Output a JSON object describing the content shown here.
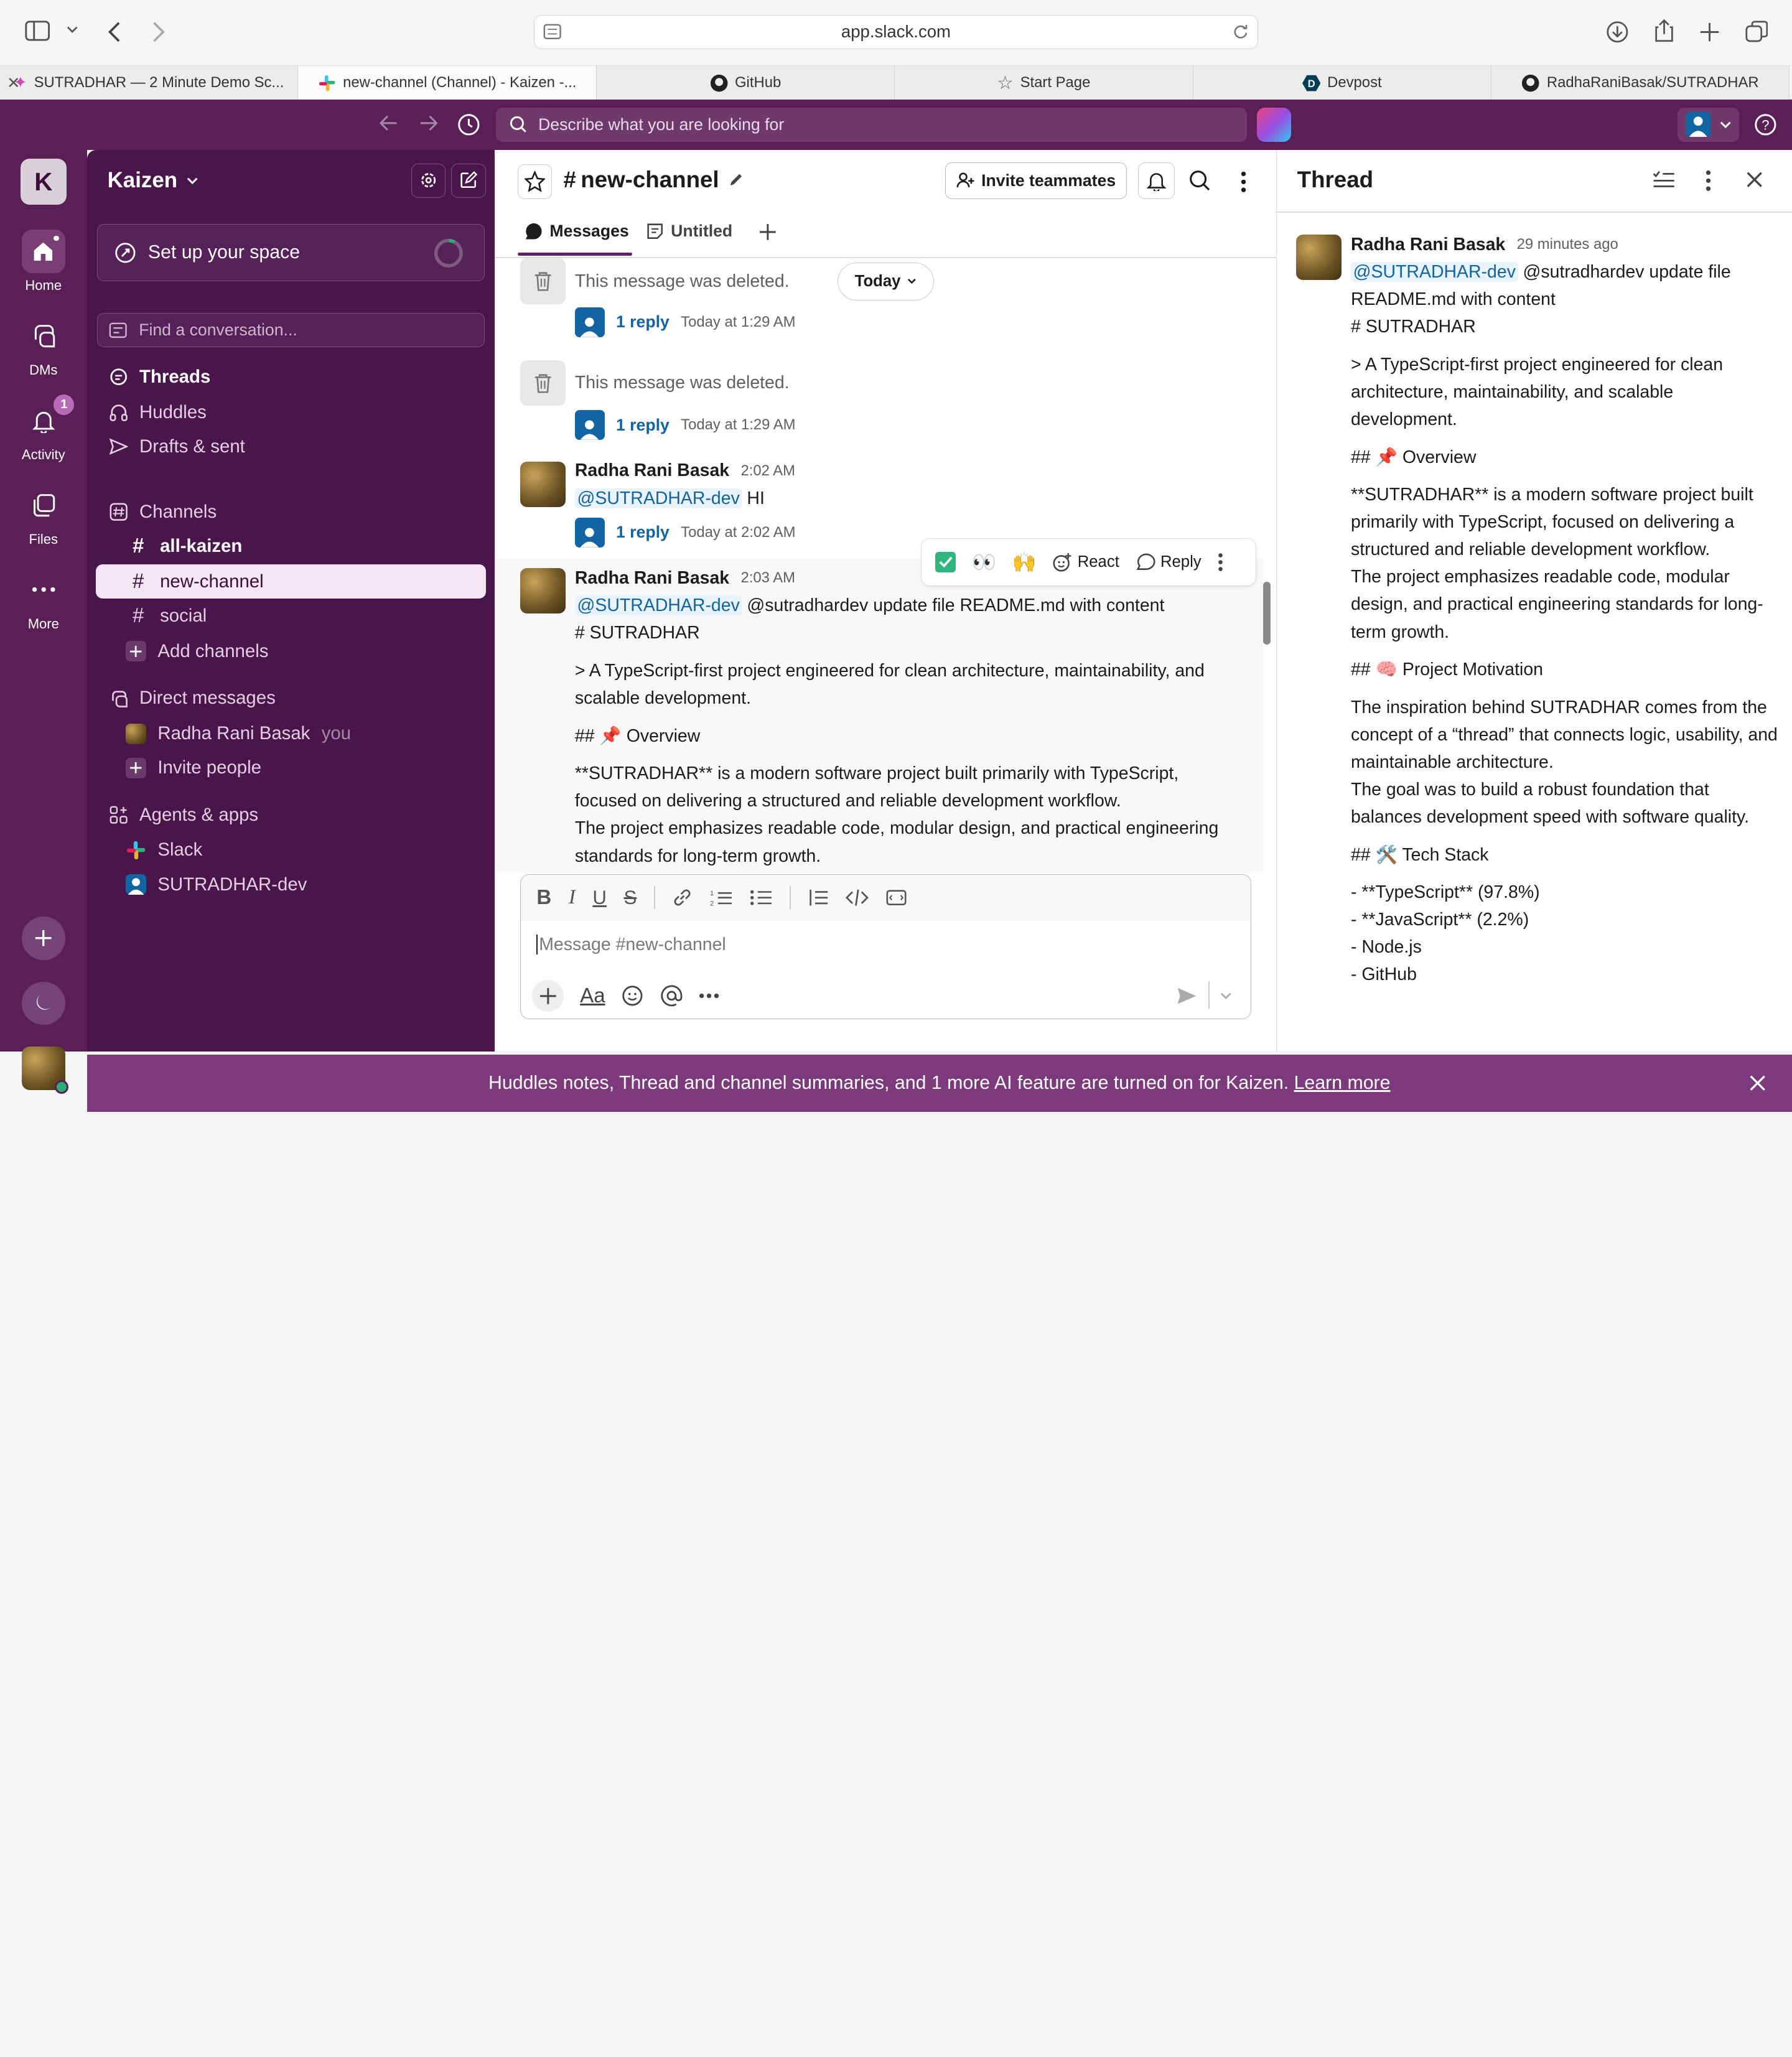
{
  "browser": {
    "url": "app.slack.com",
    "tabs": [
      {
        "label": "SUTRADHAR — 2 Minute Demo Sc...",
        "icon": "sparkle-icon"
      },
      {
        "label": "new-channel (Channel) - Kaizen -...",
        "icon": "slack-icon",
        "active": true
      },
      {
        "label": "GitHub",
        "icon": "github-icon"
      },
      {
        "label": "Start Page",
        "icon": "star-icon"
      },
      {
        "label": "Devpost",
        "icon": "devpost-icon"
      },
      {
        "label": "RadhaRaniBasak/SUTRADHAR",
        "icon": "github-icon"
      }
    ]
  },
  "topbar": {
    "search_placeholder": "Describe what you are looking for"
  },
  "rail": {
    "workspace_initial": "K",
    "items": [
      {
        "label": "Home",
        "icon": "home-icon"
      },
      {
        "label": "DMs",
        "icon": "dm-icon"
      },
      {
        "label": "Activity",
        "icon": "bell-icon",
        "badge": "1"
      },
      {
        "label": "Files",
        "icon": "files-icon"
      },
      {
        "label": "More",
        "icon": "more-icon"
      }
    ]
  },
  "sidebar": {
    "workspace": "Kaizen",
    "setup": "Set up your space",
    "find_placeholder": "Find a conversation...",
    "nav": [
      "Threads",
      "Huddles",
      "Drafts & sent"
    ],
    "channels_header": "Channels",
    "channels": [
      "all-kaizen",
      "new-channel",
      "social"
    ],
    "add_channels": "Add channels",
    "dm_header": "Direct messages",
    "dm_user": "Radha Rani Basak",
    "dm_you": "you",
    "invite_people": "Invite people",
    "apps_header": "Agents & apps",
    "apps": [
      "Slack",
      "SUTRADHAR-dev"
    ]
  },
  "channel": {
    "name": "new-channel",
    "invite": "Invite teammates",
    "tabs": [
      "Messages",
      "Untitled"
    ],
    "date_divider": "Today",
    "deleted_text": "This message was deleted.",
    "reply_label": "1 reply",
    "deleted_reply_times": [
      "Today at 1:29 AM",
      "Today at 1:29 AM"
    ],
    "msg1": {
      "author": "Radha Rani Basak",
      "time": "2:02 AM",
      "mention": "@SUTRADHAR-dev",
      "text": "HI",
      "reply_time": "Today at 2:02 AM"
    },
    "msg2": {
      "author": "Radha Rani Basak",
      "time": "2:03 AM",
      "mention": "@SUTRADHAR-dev",
      "line1": "@sutradhardev update file README.md with content",
      "line2": "# SUTRADHAR",
      "line3": "> A TypeScript-first project engineered for clean architecture, maintainability, and scalable development.",
      "line4": "## 📌 Overview",
      "line5": "**SUTRADHAR** is a modern software project built primarily with TypeScript, focused on delivering a structured and reliable development workflow.",
      "line6": "The project emphasizes readable code, modular design, and practical engineering standards for long-term growth."
    },
    "hover_actions": {
      "react": "React",
      "reply": "Reply"
    },
    "composer_placeholder": "Message #new-channel"
  },
  "thread": {
    "title": "Thread",
    "author": "Radha Rani Basak",
    "time": "29 minutes ago",
    "mention": "@SUTRADHAR-dev",
    "p1a": "@sutradhardev update file",
    "p1b": "README.md with content",
    "p1c": "# SUTRADHAR",
    "p2": "> A TypeScript-first project engineered for clean architecture, maintainability, and scalable development.",
    "h1": "## 📌 Overview",
    "p3": "**SUTRADHAR** is a modern software project built primarily with TypeScript, focused on delivering a structured and reliable development workflow.",
    "p4": "The project emphasizes readable code, modular design, and practical engineering standards for long-term growth.",
    "h2": "## 🧠 Project Motivation",
    "p5": "The inspiration behind SUTRADHAR comes from the concept of a “thread” that connects logic, usability, and maintainable architecture.",
    "p6": "The goal was to build a robust foundation that balances development speed with software quality.",
    "h3": "## 🛠️ Tech Stack",
    "list": [
      "- **TypeScript** (97.8%)",
      "- **JavaScript** (2.2%)",
      "- Node.js",
      "- GitHub"
    ]
  },
  "banner": {
    "text": "Huddles notes, Thread and channel summaries, and 1 more AI feature are turned on for Kaizen.",
    "link": "Learn more"
  }
}
